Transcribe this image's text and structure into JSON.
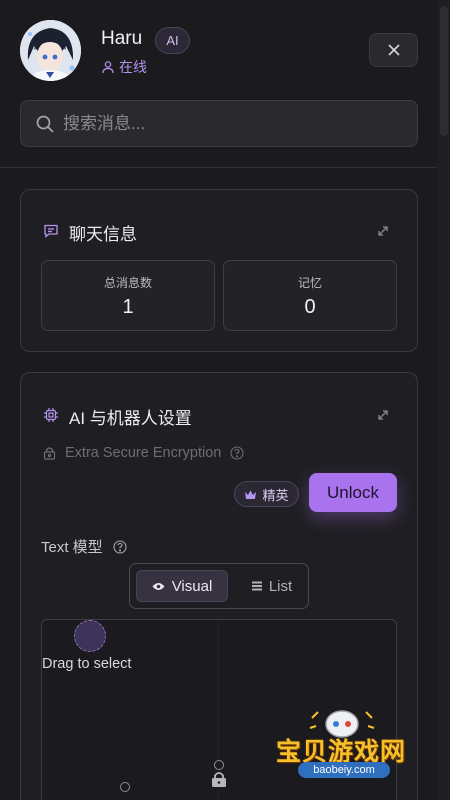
{
  "header": {
    "name": "Haru",
    "badge": "AI",
    "status": "在线",
    "search_placeholder": "搜索消息..."
  },
  "chat_info": {
    "title": "聊天信息",
    "stats": [
      {
        "label": "总消息数",
        "value": "1"
      },
      {
        "label": "记忆",
        "value": "0"
      }
    ]
  },
  "ai_settings": {
    "title": "AI 与机器人设置",
    "encryption_label": "Extra Secure Encryption",
    "elite_badge": "精英",
    "unlock_label": "Unlock",
    "model_label": "Text 模型",
    "toggle": {
      "visual": "Visual",
      "list": "List",
      "selected": "Visual"
    },
    "drag_text": "Drag to select"
  },
  "watermark": {
    "text": "宝贝游戏网",
    "url": "baobeiy.com"
  },
  "colors": {
    "accent": "#a873ec",
    "status": "#b493f0",
    "background": "#1b1a1d"
  }
}
